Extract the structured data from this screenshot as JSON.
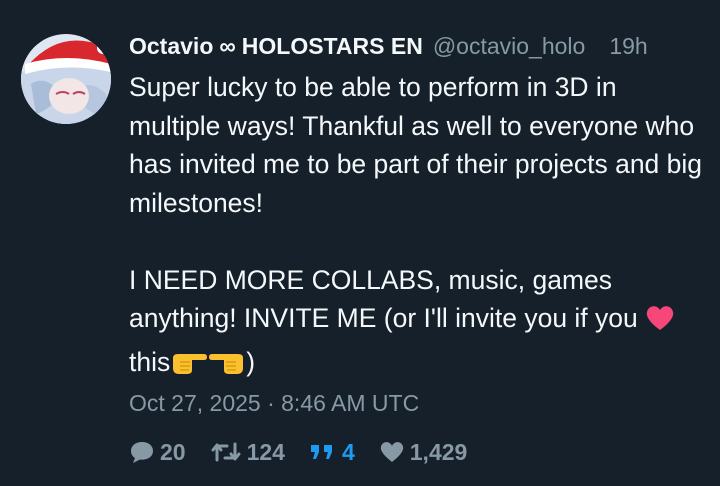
{
  "author": {
    "display_name_part1": "Octavio",
    "display_name_symbol": "∞",
    "display_name_part2": "HOLOSTARS EN",
    "handle": "@octavio_holo",
    "relative_time": "19h"
  },
  "tweet": {
    "paragraph1": "Super lucky to be able to perform in 3D in multiple ways! Thankful as well to everyone who has invited me to be part of their projects and big milestones!",
    "paragraph2_line1": "I NEED MORE COLLABS, music, games anything! INVITE ME (or I'll invite you if you",
    "paragraph2_word": "this",
    "paragraph2_end": ")",
    "emojis": [
      "heart-emoji",
      "pointing-right-emoji",
      "pointing-left-emoji"
    ]
  },
  "timestamp": "Oct 27, 2025 · 8:46 AM UTC",
  "stats": {
    "replies": "20",
    "retweets": "124",
    "quotes": "4",
    "likes": "1,429"
  },
  "colors": {
    "background": "#15202b",
    "text": "#f5f8fa",
    "muted": "#8899a6",
    "accent": "#1d9bf0"
  }
}
